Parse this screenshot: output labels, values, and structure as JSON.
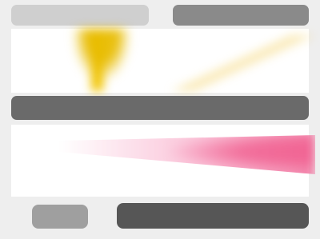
{
  "colors": {
    "background": "#eeeeee",
    "accent_yellow": "#f2c500",
    "accent_pink": "#f05a8c",
    "dark_bar": "#565656"
  },
  "top_left_button": {
    "label": ""
  },
  "top_right_button": {
    "label": ""
  },
  "middle_bar": {
    "label": ""
  },
  "bottom_left_button": {
    "label": ""
  },
  "bottom_right_button": {
    "label": ""
  }
}
